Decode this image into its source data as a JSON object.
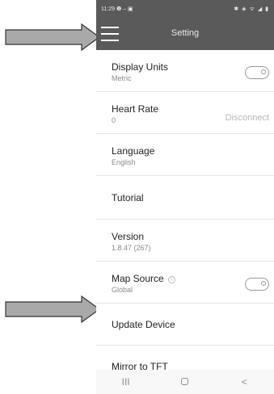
{
  "statusbar": {
    "time": "11:29",
    "left_icons": "❶ – ▣",
    "right_icons": "✱ ◈ ᯤ ◢ ▮"
  },
  "appbar": {
    "title": "Setting"
  },
  "settings": [
    {
      "label": "Display Units",
      "sub": "Metric"
    },
    {
      "label": "Heart Rate",
      "sub": "0",
      "action": "Disconnect"
    },
    {
      "label": "Language",
      "sub": "English"
    },
    {
      "label": "Tutorial"
    },
    {
      "label": "Version",
      "sub": "1.8.47 (267)"
    },
    {
      "label": "Map Source",
      "sub": "Global"
    },
    {
      "label": "Update Device"
    },
    {
      "label": "Mirror to TFT"
    }
  ],
  "navbar": {
    "recents": "III",
    "back": "<"
  },
  "colors": {
    "appbar": "#5a5a5a",
    "divider": "#e6e6e6",
    "arrow_fill": "#a9a9a9"
  }
}
